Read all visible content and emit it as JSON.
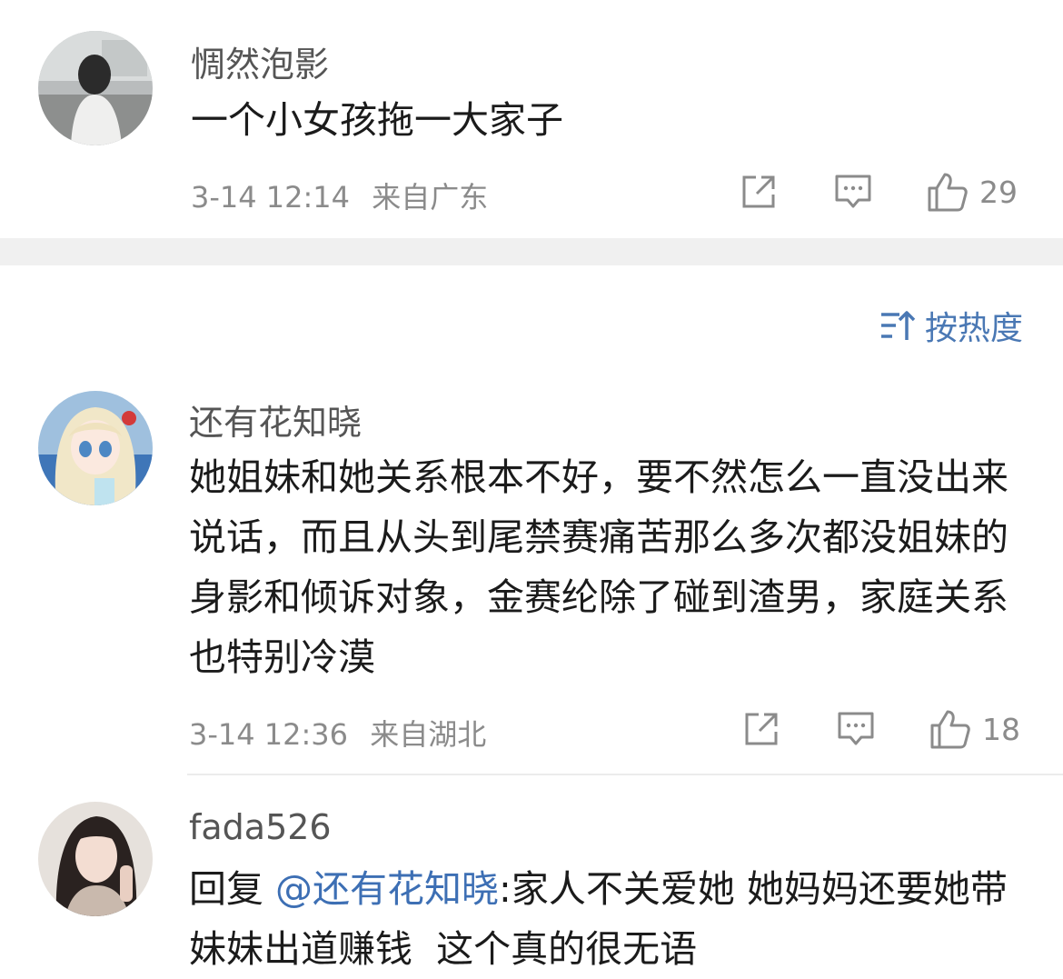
{
  "comments": [
    {
      "username": "惆然泡影",
      "text": "一个小女孩拖一大家子",
      "time": "3-14 12:14",
      "location": "来自广东",
      "likes": "29",
      "avatar_icon": "avatar-girl-window"
    },
    {
      "username": "还有花知晓",
      "text": "她姐妹和她关系根本不好，要不然怎么一直没出来说话，而且从头到尾禁赛痛苦那么多次都没姐妹的身影和倾诉对象，金赛纶除了碰到渣男，家庭关系也特别冷漠",
      "time": "3-14 12:36",
      "location": "来自湖北",
      "likes": "18",
      "avatar_icon": "avatar-anime-girl"
    },
    {
      "username": "fada526",
      "reply_prefix": "回复 ",
      "mention": "@还有花知晓",
      "text": ":家人不关爱她 她妈妈还要她带妹妹出道赚钱  这个真的很无语",
      "avatar_icon": "avatar-woman-photo"
    }
  ],
  "sort": {
    "label": "按热度",
    "icon": "sort-icon"
  },
  "icons": {
    "share": "share-icon",
    "comment": "comment-icon",
    "like": "thumbs-up-icon"
  },
  "colors": {
    "accent": "#4a78b4",
    "mention": "#3d6fb4",
    "meta": "#8b8b8b",
    "band": "#f0f0f0"
  }
}
